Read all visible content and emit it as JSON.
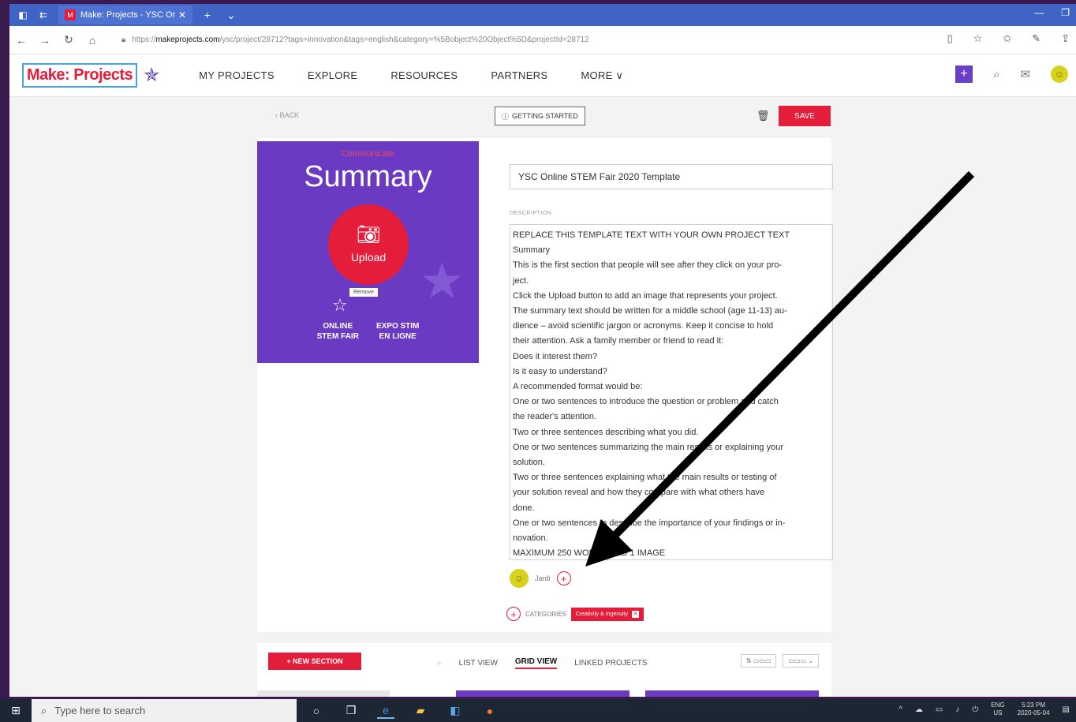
{
  "browser": {
    "tab_title": "Make: Projects - YSC Or",
    "url_prefix": "https://",
    "url_domain": "makeprojects.com",
    "url_path": "/ysc/project/28712?tags=innovation&tags=english&category=%5Bobject%20Object%5D&projectId=28712"
  },
  "header": {
    "logo": "Make: Projects",
    "nav": [
      "MY PROJECTS",
      "EXPLORE",
      "RESOURCES",
      "PARTNERS",
      "MORE ∨"
    ]
  },
  "actions": {
    "back": "‹ BACK",
    "getting_started": "GETTING STARTED",
    "save": "SAVE"
  },
  "summary_image": {
    "tag": "Communicate",
    "title": "Summary",
    "upload": "Upload",
    "remove": "Remove",
    "fair_en": "ONLINE\nSTEM FAIR",
    "fair_fr": "EXPO STIM\nEN LIGNE"
  },
  "form": {
    "title_value": "YSC Online STEM Fair 2020 Template",
    "description_label": "DESCRIPTION",
    "description_lines": [
      "REPLACE THIS TEMPLATE TEXT WITH YOUR OWN PROJECT TEXT",
      "Summary",
      "This is the first section that people will see after they click on your pro-",
      "ject.",
      " Click the Upload button to add an image that represents your project.",
      "The summary text should be written for a middle school (age 11-13) au-",
      "dience – avoid scientific jargon or acronyms. Keep it concise to hold",
      "their attention. Ask a family member or friend to read it:",
      "Does it interest them?",
      "Is it easy to understand?",
      "A recommended format would be:",
      "One or two sentences to introduce the question or problem and catch",
      "the reader's attention.",
      "Two or three sentences describing what you did.",
      "One or two sentences summarizing the main results or explaining your",
      "solution.",
      "Two or three sentences explaining what the main results or testing of",
      "your solution reveal and how they compare with what others have",
      "done.",
      "One or two sentences to describe the importance of your findings or in-",
      "novation.",
      "MAXIMUM 250 WORDS AND 1 IMAGE"
    ],
    "collaborator_name": "Jardi",
    "categories_label": "CATEGORIES",
    "category_chip": "Creativity & Ingenuity"
  },
  "sections_bar": {
    "new_section": "+ NEW SECTION",
    "views": [
      "LIST VIEW",
      "GRID VIEW",
      "LINKED PROJECTS"
    ],
    "active_view": "GRID VIEW"
  },
  "taskbar": {
    "search_placeholder": "Type here to search",
    "lang_top": "ENG",
    "lang_bottom": "US",
    "time": "5:23 PM",
    "date": "2020-05-04"
  }
}
